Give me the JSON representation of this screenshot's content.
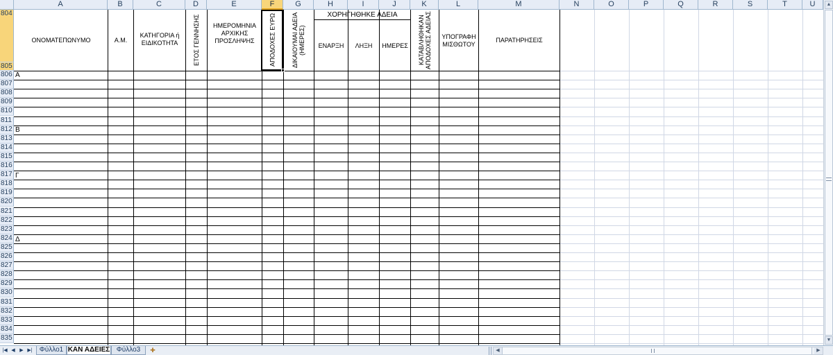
{
  "columns": [
    "A",
    "B",
    "C",
    "D",
    "E",
    "F",
    "G",
    "H",
    "I",
    "J",
    "K",
    "L",
    "M",
    "N",
    "O",
    "P",
    "Q",
    "R",
    "S",
    "T",
    "U"
  ],
  "selected_column": "F",
  "row_numbers": [
    "804",
    "805",
    "806",
    "807",
    "808",
    "809",
    "810",
    "811",
    "812",
    "813",
    "814",
    "815",
    "816",
    "817",
    "818",
    "819",
    "820",
    "821",
    "822",
    "823",
    "824",
    "825",
    "826",
    "827",
    "828",
    "829",
    "830",
    "831",
    "832",
    "833",
    "834",
    "835"
  ],
  "header_labels": {
    "name": "ΟΝΟΜΑΤΕΠΩΝΥΜΟ",
    "am": "Α.Μ.",
    "category": "ΚΑΤΗΓΟΡΙΑ ή ΕΙΔΙΚΟΤΗΤΑ",
    "birth_year": "ΕΤΟΣ ΓΕΝΝΗΣΗΣ",
    "hire_date": "ΗΜΕΡΟΜΗΝΙΑ ΑΡΧΙΚΗΣ ΠΡΟΣΛΗΨΗΣ",
    "wages": "ΑΠΟΔΟΧΕΣ ΕΥΡΩ",
    "entitled_leave": "ΔΙΚΑΙΟΥΜΑΙ ΑΔΕΙΑ (ΗΜΕΡΕΣ)",
    "granted_leave": "ΧΟΡΗΓΗΘΗΚΕ ΑΔΕΙΑ",
    "start": "ΕΝΑΡΞΗ",
    "end": "ΛΗΞΗ",
    "days": "ΗΜΕΡΕΣ",
    "leave_pay": "ΚΑΤΑΒΛΗΘΗΚΑΝ ΑΠΟΔΟΧΕΣ ΑΔΕΙΑΣ",
    "signature": "ΥΠΟΓΡΑΦΗ ΜΙΣΘΩΤΟΥ",
    "remarks": "ΠΑΡΑΤΗΡΗΣΕΙΣ"
  },
  "section_letters": {
    "806": "Α",
    "812": "Β",
    "817": "Γ",
    "824": "Δ"
  },
  "sheet_tabs": [
    {
      "label": "Φύλλο1",
      "active": false
    },
    {
      "label": "ΚΑΝ ΑΔΕΙΕΣ",
      "active": true
    },
    {
      "label": "Φύλλο3",
      "active": false
    }
  ],
  "colors": {
    "header_bg": "#e6ecf6",
    "selected_header_bg": "#f8d57a",
    "gridline": "#d0d7e5",
    "border": "#000000"
  },
  "icons": {
    "nav_first": "first-sheet-icon",
    "nav_prev": "prev-sheet-icon",
    "nav_next": "next-sheet-icon",
    "nav_last": "last-sheet-icon",
    "new_sheet": "insert-sheet-icon"
  }
}
